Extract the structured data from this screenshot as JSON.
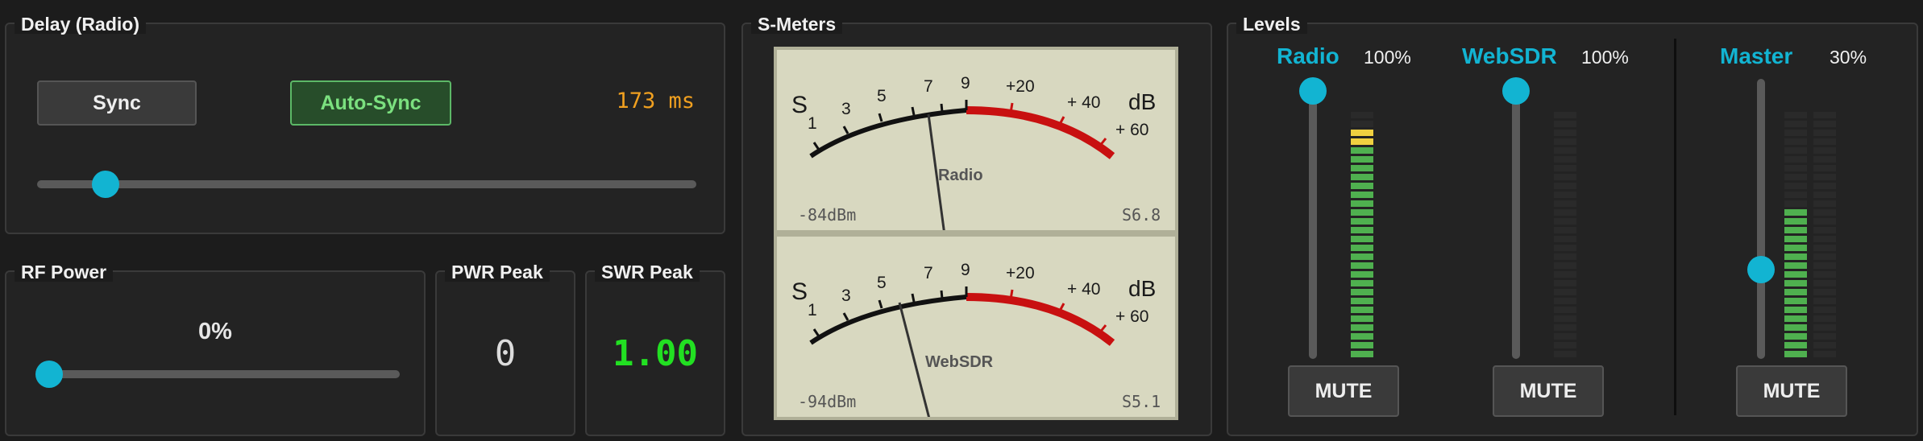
{
  "delay": {
    "title": "Delay (Radio)",
    "sync_label": "Sync",
    "autosync_label": "Auto-Sync",
    "value_text": "173 ms",
    "slider_fraction": 0.1
  },
  "rf_power": {
    "title": "RF Power",
    "value_text": "0%",
    "slider_fraction": 0.0
  },
  "pwr_peak": {
    "title": "PWR Peak",
    "value": "0"
  },
  "swr_peak": {
    "title": "SWR Peak",
    "value": "1.00"
  },
  "smeters": {
    "title": "S-Meters",
    "scale_labels": [
      "S",
      "1",
      "3",
      "5",
      "7",
      "9",
      "+20",
      "+ 40",
      "+ 60",
      "dB"
    ],
    "meters": [
      {
        "name": "Radio",
        "dbm": "-84dBm",
        "reading": "S6.8"
      },
      {
        "name": "WebSDR",
        "dbm": "-94dBm",
        "reading": "S5.1"
      }
    ]
  },
  "levels": {
    "title": "Levels",
    "channels": [
      {
        "name": "Radio",
        "percent": "100%",
        "fader_fraction": 1.0,
        "meter_level": 0.92,
        "mute_label": "MUTE"
      },
      {
        "name": "WebSDR",
        "percent": "100%",
        "fader_fraction": 1.0,
        "meter_level": 0.0,
        "mute_label": "MUTE"
      },
      {
        "name": "Master",
        "percent": "30%",
        "fader_fraction": 0.3,
        "meter_level": 0.6,
        "mute_label": "MUTE"
      }
    ]
  },
  "colors": {
    "accent": "#12b4d2",
    "delay_value": "#f0a020",
    "swr_value": "#22e022",
    "meter_red": "#c81010"
  }
}
